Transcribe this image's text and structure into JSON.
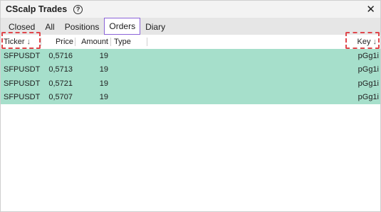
{
  "window": {
    "title": "CScalp Trades"
  },
  "tabs": [
    {
      "label": "Closed",
      "active": false
    },
    {
      "label": "All",
      "active": false
    },
    {
      "label": "Positions",
      "active": false
    },
    {
      "label": "Orders",
      "active": true
    },
    {
      "label": "Diary",
      "active": false
    }
  ],
  "columns": {
    "ticker": "Ticker",
    "price": "Price",
    "amount": "Amount",
    "type": "Type",
    "key": "Key",
    "sort_arrow": "↓"
  },
  "rows": [
    {
      "ticker": "SFPUSDT",
      "price": "0,5716",
      "amount": "19",
      "type": "",
      "key": "pGg1i"
    },
    {
      "ticker": "SFPUSDT",
      "price": "0,5713",
      "amount": "19",
      "type": "",
      "key": "pGg1i"
    },
    {
      "ticker": "SFPUSDT",
      "price": "0,5721",
      "amount": "19",
      "type": "",
      "key": "pGg1i"
    },
    {
      "ticker": "SFPUSDT",
      "price": "0,5707",
      "amount": "19",
      "type": "",
      "key": "pGg1i"
    }
  ],
  "colors": {
    "row_bg": "#a6dfcb",
    "active_tab_border": "#8a63d8",
    "highlight": "#e0474c"
  },
  "icons": {
    "help": "question-circle-icon",
    "close": "close-icon"
  }
}
